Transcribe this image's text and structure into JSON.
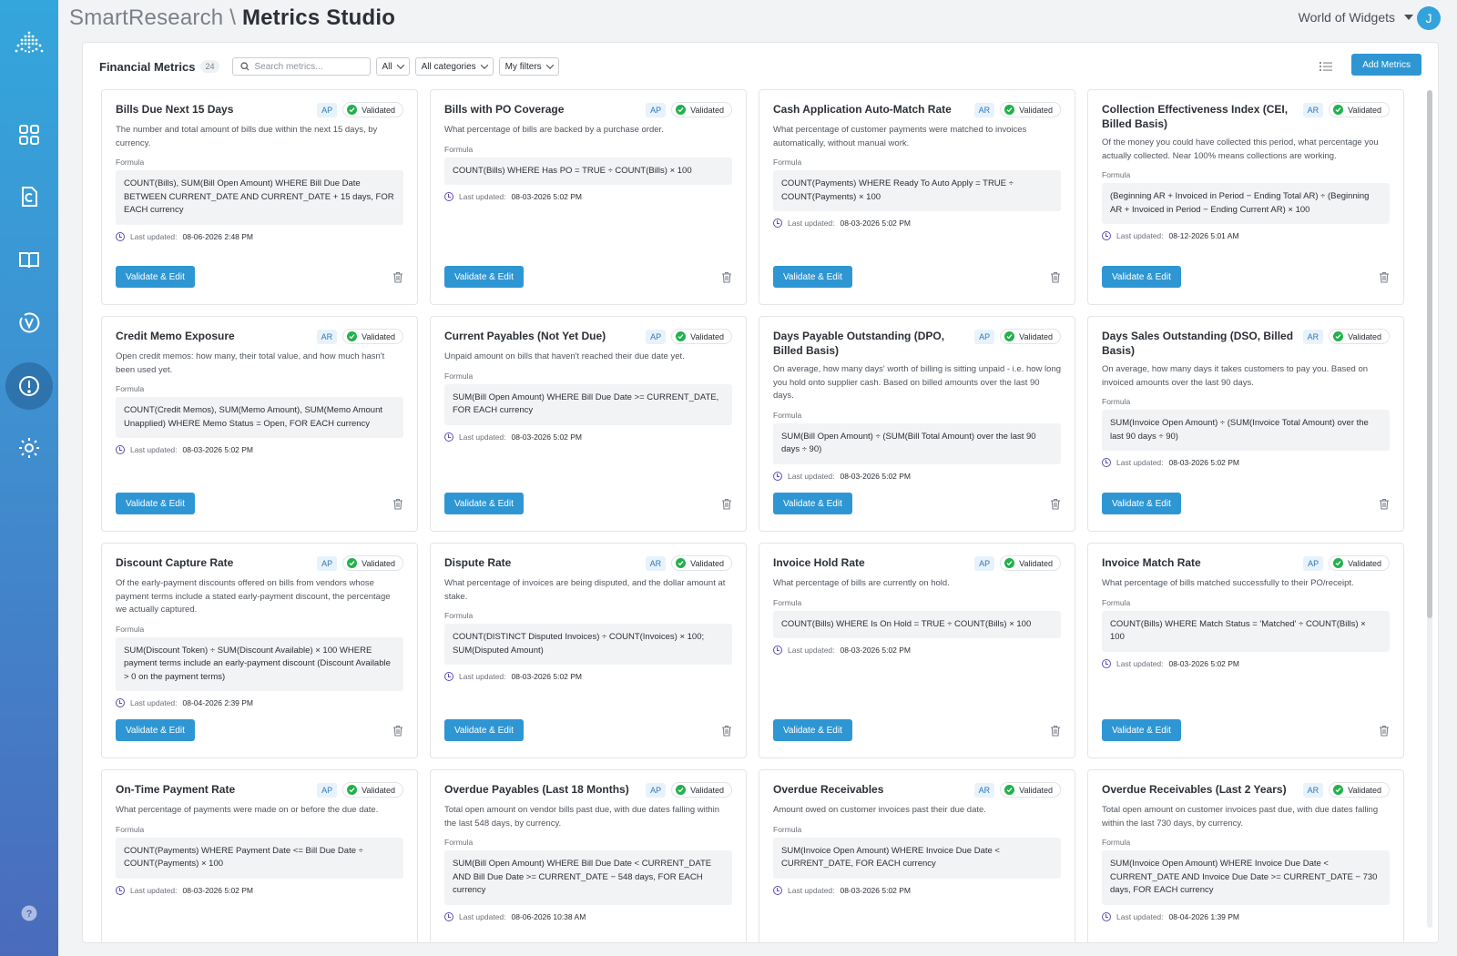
{
  "header": {
    "brand": "SmartResearch \\",
    "title": "Metrics Studio",
    "org": "World of Widgets",
    "user_initial": "J"
  },
  "toolbar": {
    "title": "Financial Metrics",
    "count": "24",
    "search_placeholder": "Search metrics...",
    "filter_all": "All",
    "filter_categories": "All categories",
    "filter_my": "My filters",
    "add_label": "Add Metrics"
  },
  "labels": {
    "formula": "Formula",
    "last_updated": "Last updated:",
    "validate": "Validate & Edit",
    "validated": "Validated"
  },
  "colors": {
    "accent": "#2f96d4",
    "validated": "#22b14c",
    "tag_bg": "#e8f2fb"
  },
  "cards": [
    {
      "title": "Bills Due Next 15 Days",
      "tag": "AP",
      "desc": "The number and total amount of bills due within the next 15 days, by currency.",
      "formula": "COUNT(Bills), SUM(Bill Open Amount) WHERE Bill Due Date BETWEEN CURRENT_DATE AND CURRENT_DATE + 15 days, FOR EACH currency",
      "updated": "08-06-2026 2:48 PM"
    },
    {
      "title": "Bills with PO Coverage",
      "tag": "AP",
      "desc": "What percentage of bills are backed by a purchase order.",
      "formula": "COUNT(Bills) WHERE Has PO = TRUE ÷ COUNT(Bills) × 100",
      "updated": "08-03-2026 5:02 PM"
    },
    {
      "title": "Cash Application Auto-Match Rate",
      "tag": "AR",
      "desc": "What percentage of customer payments were matched to invoices automatically, without manual work.",
      "formula": "COUNT(Payments) WHERE Ready To Auto Apply = TRUE ÷ COUNT(Payments) × 100",
      "updated": "08-03-2026 5:02 PM"
    },
    {
      "title": "Collection Effectiveness Index (CEI, Billed Basis)",
      "tag": "AR",
      "desc": "Of the money you could have collected this period, what percentage you actually collected. Near 100% means collections are working.",
      "formula": "(Beginning AR + Invoiced in Period − Ending Total AR) ÷ (Beginning AR + Invoiced in Period − Ending Current AR) × 100",
      "updated": "08-12-2026 5:01 AM"
    },
    {
      "title": "Credit Memo Exposure",
      "tag": "AR",
      "desc": "Open credit memos: how many, their total value, and how much hasn't been used yet.",
      "formula": "COUNT(Credit Memos), SUM(Memo Amount), SUM(Memo Amount Unapplied) WHERE Memo Status = Open, FOR EACH currency",
      "updated": "08-03-2026 5:02 PM"
    },
    {
      "title": "Current Payables (Not Yet Due)",
      "tag": "AP",
      "desc": "Unpaid amount on bills that haven't reached their due date yet.",
      "formula": "SUM(Bill Open Amount) WHERE Bill Due Date >= CURRENT_DATE, FOR EACH currency",
      "updated": "08-03-2026 5:02 PM"
    },
    {
      "title": "Days Payable Outstanding (DPO, Billed Basis)",
      "tag": "AP",
      "desc": "On average, how many days' worth of billing is sitting unpaid - i.e. how long you hold onto supplier cash. Based on billed amounts over the last 90 days.",
      "formula": "SUM(Bill Open Amount) ÷ (SUM(Bill Total Amount) over the last 90 days ÷ 90)",
      "updated": "08-03-2026 5:02 PM"
    },
    {
      "title": "Days Sales Outstanding (DSO, Billed Basis)",
      "tag": "AR",
      "desc": "On average, how many days it takes customers to pay you. Based on invoiced amounts over the last 90 days.",
      "formula": "SUM(Invoice Open Amount) ÷ (SUM(Invoice Total Amount) over the last 90 days ÷ 90)",
      "updated": "08-03-2026 5:02 PM"
    },
    {
      "title": "Discount Capture Rate",
      "tag": "AP",
      "desc": "Of the early-payment discounts offered on bills from vendors whose payment terms include a stated early-payment discount, the percentage we actually captured.",
      "formula": "SUM(Discount Token) ÷ SUM(Discount Available) × 100 WHERE payment terms include an early-payment discount (Discount Available > 0 on the payment terms)",
      "updated": "08-04-2026 2:39 PM"
    },
    {
      "title": "Dispute Rate",
      "tag": "AR",
      "desc": "What percentage of invoices are being disputed, and the dollar amount at stake.",
      "formula": "COUNT(DISTINCT Disputed Invoices) ÷ COUNT(Invoices) × 100; SUM(Disputed Amount)",
      "updated": "08-03-2026 5:02 PM"
    },
    {
      "title": "Invoice Hold Rate",
      "tag": "AP",
      "desc": "What percentage of bills are currently on hold.",
      "formula": "COUNT(Bills) WHERE Is On Hold = TRUE ÷ COUNT(Bills) × 100",
      "updated": "08-03-2026 5:02 PM"
    },
    {
      "title": "Invoice Match Rate",
      "tag": "AP",
      "desc": "What percentage of bills matched successfully to their PO/receipt.",
      "formula": "COUNT(Bills) WHERE Match Status = 'Matched' ÷ COUNT(Bills) × 100",
      "updated": "08-03-2026 5:02 PM"
    },
    {
      "title": "On-Time Payment Rate",
      "tag": "AP",
      "desc": "What percentage of payments were made on or before the due date.",
      "formula": "COUNT(Payments) WHERE Payment Date <= Bill Due Date ÷ COUNT(Payments) × 100",
      "updated": "08-03-2026 5:02 PM"
    },
    {
      "title": "Overdue Payables (Last 18 Months)",
      "tag": "AP",
      "desc": "Total open amount on vendor bills past due, with due dates falling within the last 548 days, by currency.",
      "formula": "SUM(Bill Open Amount) WHERE Bill Due Date < CURRENT_DATE AND Bill Due Date >= CURRENT_DATE − 548 days, FOR EACH currency",
      "updated": "08-06-2026 10:38 AM"
    },
    {
      "title": "Overdue Receivables",
      "tag": "AR",
      "desc": "Amount owed on customer invoices past their due date.",
      "formula": "SUM(Invoice Open Amount) WHERE Invoice Due Date < CURRENT_DATE, FOR EACH currency",
      "updated": "08-03-2026 5:02 PM"
    },
    {
      "title": "Overdue Receivables (Last 2 Years)",
      "tag": "AR",
      "desc": "Total open amount on customer invoices past due, with due dates falling within the last 730 days, by currency.",
      "formula": "SUM(Invoice Open Amount) WHERE Invoice Due Date < CURRENT_DATE AND Invoice Due Date >= CURRENT_DATE − 730 days, FOR EACH currency",
      "updated": "08-04-2026 1:39 PM"
    }
  ]
}
